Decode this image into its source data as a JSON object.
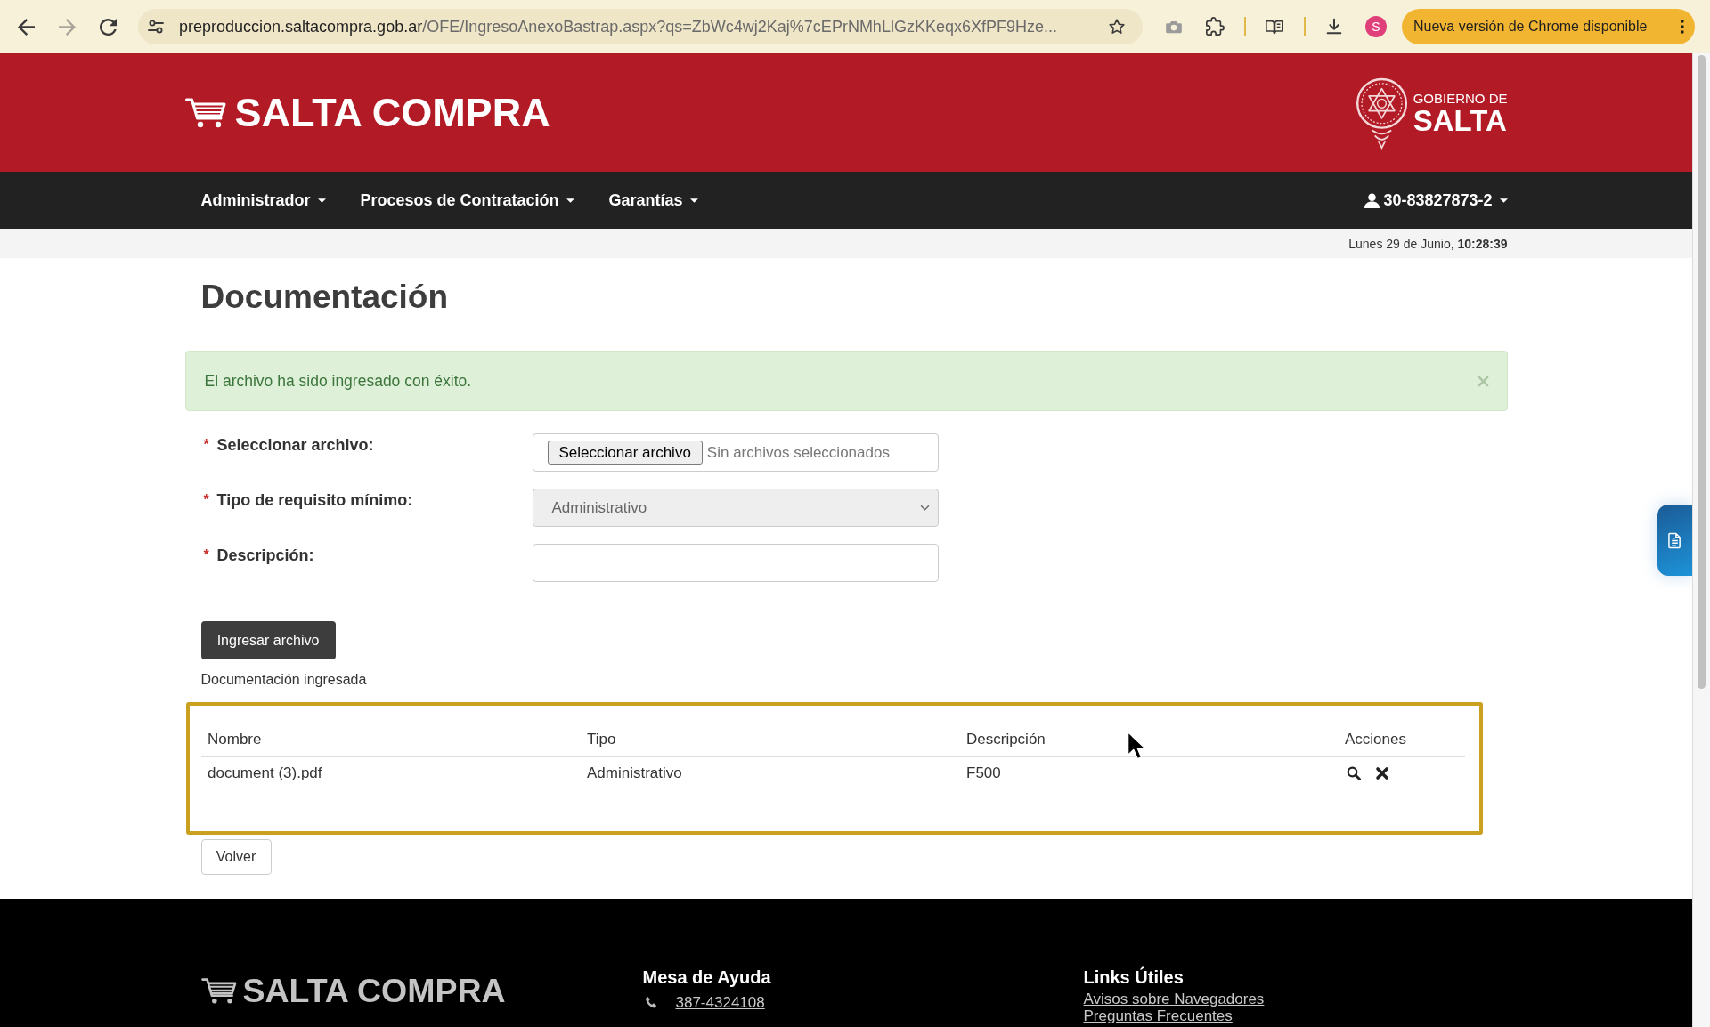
{
  "browser": {
    "nav_buttons": [
      {
        "kind": "back",
        "disabled": false
      },
      {
        "kind": "forward",
        "disabled": true
      },
      {
        "kind": "reload",
        "disabled": false
      }
    ],
    "url_host": "preproduccion.saltacompra.gob.ar",
    "url_rest": "/OFE/IngresoAnexoBastrap.aspx?qs=ZbWc4wj2Kaj%7cEPrNMhLlGzKKeqx6XfPF9Hze...",
    "profile_initial": "S",
    "update_button": "Nueva versión de Chrome disponible"
  },
  "header": {
    "logo": "SALTA COMPRA",
    "government_logo": {
      "line_1": "GOBIERNO DE",
      "line_2": "SALTA"
    }
  },
  "nav": {
    "menus": [
      {
        "label": "Administrador"
      },
      {
        "label": "Procesos de Contratación"
      },
      {
        "label": "Garantías"
      }
    ],
    "user": "30-83827873-2"
  },
  "date": "Lunes 29 de Junio, **10:28:39**",
  "page_title": "Documentación",
  "alert": {
    "message": "El archivo ha sido ingresado con éxito."
  },
  "form": {
    "fields": [
      {
        "kind": "file",
        "required_mark": "*",
        "label": "Seleccionar archivo:",
        "button": "Seleccionar archivo",
        "status": "Sin archivos seleccionados",
        "disabled": false
      },
      {
        "kind": "select",
        "required_mark": "*",
        "label": "Tipo de requisito mínimo:",
        "value": "Administrativo",
        "disabled": true
      },
      {
        "kind": "text",
        "required_mark": "*",
        "label": "Descripción:",
        "disabled": false
      }
    ],
    "submit": "Ingresar archivo"
  },
  "documents": {
    "caption": "Documentación ingresada",
    "highlighted": true,
    "columns": [
      "Nombre",
      "Tipo",
      "Descripción",
      "Acciones"
    ],
    "rows": [
      {
        "cells": [
          "document (3).pdf",
          "Administrativo",
          "F500"
        ]
      }
    ]
  },
  "back_button": "Volver",
  "footer": {
    "logo": "SALTA COMPRA",
    "help": {
      "title": "Mesa de Ayuda",
      "phone": "387-4324108"
    },
    "links": {
      "title": "Links Útiles",
      "items": [
        "Avisos sobre Navegadores",
        "Preguntas Frecuentes"
      ]
    }
  }
}
